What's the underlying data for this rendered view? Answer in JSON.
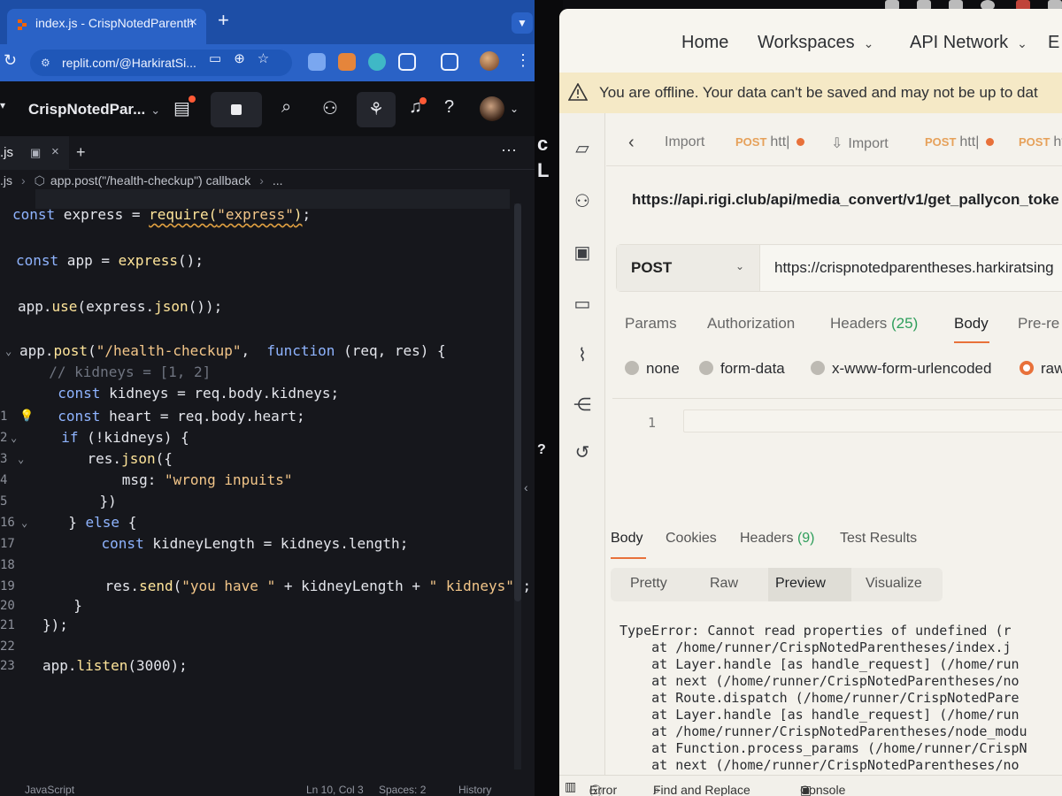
{
  "chrome": {
    "tab_title": "index.js - CrispNotedParenth",
    "new_tab": "+",
    "url": "replit.com/@HarkiratSi..."
  },
  "replit": {
    "repl_name": "CrispNotedPar...",
    "file_tab": ".js",
    "breadcrumb": {
      "file": ".js",
      "symbol": "app.post(\"/health-checkup\") callback",
      "more": "..."
    },
    "code": [
      {
        "ln": "",
        "html": "<span class=\"kw\">const</span> express = <span class=\"fn squiggle\">require(<span class=\"str\">\"express\"</span>)</span>;"
      },
      {
        "ln": "",
        "html": ""
      },
      {
        "ln": "",
        "html": "<span class=\"kw\">const</span> app = <span class=\"fn\">express</span>();"
      },
      {
        "ln": "",
        "html": ""
      },
      {
        "ln": "",
        "html": "app.<span class=\"fn\">use</span>(express.<span class=\"fn\">json</span>());"
      },
      {
        "ln": "",
        "html": ""
      },
      {
        "ln": "",
        "html": "app.<span class=\"fn\">post</span>(<span class=\"str\">\"/health-checkup\"</span>,  <span class=\"kw\">function</span> (req, res) {"
      },
      {
        "ln": "",
        "html": "  <span class=\"cm\">// kidneys = [1, 2]</span>"
      },
      {
        "ln": "",
        "html": "  <span class=\"kw\">const</span> kidneys = req.body.kidneys;"
      },
      {
        "ln": "1",
        "html": "  <span class=\"kw\">const</span> heart = req.body.heart;"
      },
      {
        "ln": "2",
        "html": "  <span class=\"kw\">if</span> (!kidneys) {"
      },
      {
        "ln": "3",
        "html": "    res.<span class=\"fn\">json</span>({"
      },
      {
        "ln": "4",
        "html": "      msg: <span class=\"str\">\"wrong inpuits\"</span>"
      },
      {
        "ln": "5",
        "html": "    })"
      },
      {
        "ln": "16",
        "html": "  } <span class=\"kw\">else</span> {"
      },
      {
        "ln": "17",
        "html": "    <span class=\"kw\">const</span> kidneyLength = kidneys.length;"
      },
      {
        "ln": "18",
        "html": ""
      },
      {
        "ln": "19",
        "html": "    res.<span class=\"fn\">send</span>(<span class=\"str\">\"you have \"</span> + kidneyLength + <span class=\"str\">\" kidneys\"</span>);"
      },
      {
        "ln": "20",
        "html": "  }"
      },
      {
        "ln": "21",
        "html": "});"
      },
      {
        "ln": "22",
        "html": ""
      },
      {
        "ln": "23",
        "html": "app.<span class=\"fn\">listen</span>(3000);"
      }
    ],
    "status_bar": {
      "language": "JavaScript",
      "position": "Ln 10, Col 3",
      "spaces": "Spaces: 2",
      "history": "History"
    }
  },
  "postman": {
    "nav": {
      "home": "Home",
      "workspaces": "Workspaces",
      "api_network": "API Network"
    },
    "offline_message": "You are offline. Your data can't be saved and may not be up to dat",
    "tabs": [
      {
        "label": "Import",
        "method": "",
        "unsaved": false
      },
      {
        "label": "htt|",
        "method": "POST",
        "unsaved": true
      },
      {
        "label": "Import",
        "method": "",
        "unsaved": false
      },
      {
        "label": "htt|",
        "method": "POST",
        "unsaved": true
      },
      {
        "label": "htt",
        "method": "POST",
        "unsaved": false
      }
    ],
    "request_title": "https://api.rigi.club/api/media_convert/v1/get_pallycon_toke",
    "method": "POST",
    "url": "https://crispnotedparentheses.harkiratsing",
    "request_tabs": {
      "params": "Params",
      "authorization": "Authorization",
      "headers": "Headers",
      "headers_count": "(25)",
      "body": "Body",
      "pre_request": "Pre-re"
    },
    "body_types": [
      "none",
      "form-data",
      "x-www-form-urlencoded",
      "raw"
    ],
    "selected_body_type": "raw",
    "body_line_number": "1",
    "response_tabs": {
      "body": "Body",
      "cookies": "Cookies",
      "headers": "Headers",
      "headers_count": "(9)",
      "test_results": "Test Results"
    },
    "view_modes": [
      "Pretty",
      "Raw",
      "Preview",
      "Visualize"
    ],
    "selected_view": "Preview",
    "response_lines": [
      "TypeError: Cannot read properties of undefined (r",
      "    at /home/runner/CrispNotedParentheses/index.j",
      "    at Layer.handle [as handle_request] (/home/run",
      "    at next (/home/runner/CrispNotedParentheses/no",
      "    at Route.dispatch (/home/runner/CrispNotedPare",
      "    at Layer.handle [as handle_request] (/home/run",
      "    at /home/runner/CrispNotedParentheses/node_modu",
      "    at Function.process_params (/home/runner/CrispN",
      "    at next (/home/runner/CrispNotedParentheses/no"
    ],
    "status_bar": {
      "error": "Error",
      "find_replace": "Find and Replace",
      "console": "Console"
    }
  },
  "middle": {
    "char_c": "c",
    "char_l": "L",
    "char_q": "?"
  },
  "colors": {
    "chrome_blue": "#2a62c6",
    "editor_bg": "#16171c",
    "postman_bg": "#f4f2ec",
    "postman_accent": "#e8713a",
    "offline_banner": "#f5e9c6"
  }
}
